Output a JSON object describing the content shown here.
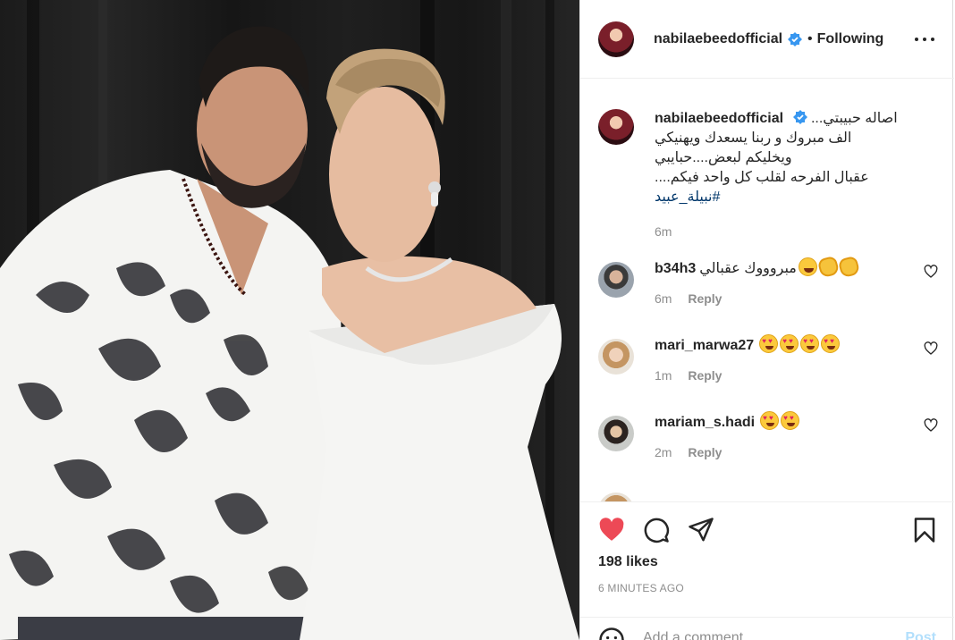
{
  "post": {
    "author": "nabilaebeedofficial",
    "follow_status": "Following",
    "separator": "•",
    "caption_lines": [
      "اصاله حبيبتي...",
      "الف مبروك و ربنا يسعدك ويهنيكي",
      "ويخليكم لبعض....حبايبي",
      "عقبال الفرحه لقلب كل واحد فيكم....",
      "#نبيلة_عبيد"
    ],
    "caption_time": "6m",
    "likes": "198 likes",
    "time_ago": "6 MINUTES AGO"
  },
  "comments": [
    {
      "username": "b34h3",
      "text": "مبروووك عقبالي",
      "emojis": [
        "clap",
        "clap",
        "laugh"
      ],
      "time": "6m",
      "reply": "Reply"
    },
    {
      "username": "mari_marwa27",
      "text": "",
      "emojis": [
        "love",
        "love",
        "love",
        "love"
      ],
      "time": "1m",
      "reply": "Reply"
    },
    {
      "username": "mariam_s.hadi",
      "text": "",
      "emojis": [
        "love",
        "love"
      ],
      "time": "2m",
      "reply": "Reply"
    }
  ],
  "add_comment": {
    "placeholder": "Add a comment…",
    "post_label": "Post"
  },
  "colors": {
    "like_red": "#ed4956",
    "verified_blue": "#3897f0",
    "link_blue": "#00376b",
    "post_disabled": "#b2dffc"
  },
  "icons": [
    "verified-badge-icon",
    "more-options-icon",
    "heart-icon",
    "comment-icon",
    "share-icon",
    "bookmark-icon",
    "emoji-icon"
  ]
}
